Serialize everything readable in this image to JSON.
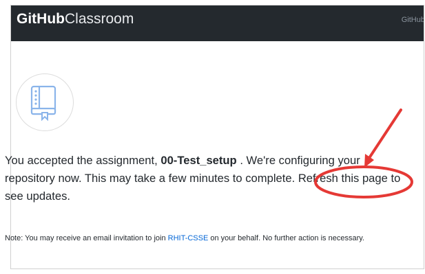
{
  "header": {
    "brand_bold": "GitHub",
    "brand_light": "Classroom",
    "link_label": "GitHub"
  },
  "icon": {
    "semantic": "book-icon"
  },
  "message": {
    "prefix": "You accepted the assignment,",
    "assignment_name": "00-Test_setup",
    "middle": ". We're configuring your repository now. This may take a few minutes to complete.",
    "refresh_label": "Refresh this page",
    "suffix": "to see updates."
  },
  "note": {
    "prefix": "Note: You may receive an email invitation to join",
    "org_name": "RHIT-CSSE",
    "suffix": "on your behalf. No further action is necessary."
  },
  "annotation": {
    "color": "#e53935"
  }
}
